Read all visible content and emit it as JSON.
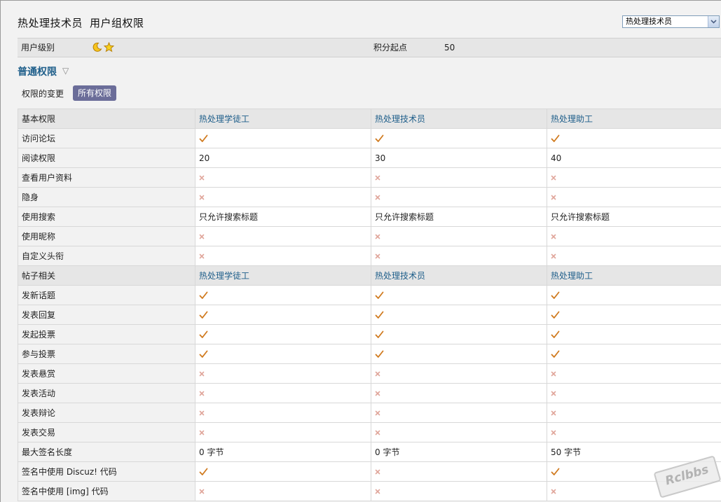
{
  "header": {
    "group_name": "热处理技术员",
    "page_label": "用户组权限",
    "selector_value": "热处理技术员"
  },
  "level_row": {
    "label": "用户级别",
    "points_label": "积分起点",
    "points_value": "50"
  },
  "section": {
    "title": "普通权限",
    "toggle": "▽",
    "tabs": [
      "权限的变更",
      "所有权限"
    ]
  },
  "table": {
    "rows": [
      {
        "type": "head",
        "cells": [
          "基本权限",
          "热处理学徒工",
          "热处理技术员",
          "热处理助工"
        ]
      },
      {
        "type": "row",
        "cells": [
          "访问论坛",
          "✓",
          "✓",
          "✓"
        ]
      },
      {
        "type": "row",
        "cells": [
          "阅读权限",
          "20",
          "30",
          "40"
        ]
      },
      {
        "type": "row",
        "cells": [
          "查看用户资料",
          "×",
          "×",
          "×"
        ]
      },
      {
        "type": "row",
        "cells": [
          "隐身",
          "×",
          "×",
          "×"
        ]
      },
      {
        "type": "row",
        "cells": [
          "使用搜索",
          "只允许搜索标题",
          "只允许搜索标题",
          "只允许搜索标题"
        ]
      },
      {
        "type": "row",
        "cells": [
          "使用昵称",
          "×",
          "×",
          "×"
        ]
      },
      {
        "type": "row",
        "cells": [
          "自定义头衔",
          "×",
          "×",
          "×"
        ]
      },
      {
        "type": "head",
        "cells": [
          "帖子相关",
          "热处理学徒工",
          "热处理技术员",
          "热处理助工"
        ]
      },
      {
        "type": "row",
        "cells": [
          "发新话题",
          "✓",
          "✓",
          "✓"
        ]
      },
      {
        "type": "row",
        "cells": [
          "发表回复",
          "✓",
          "✓",
          "✓"
        ]
      },
      {
        "type": "row",
        "cells": [
          "发起投票",
          "✓",
          "✓",
          "✓"
        ]
      },
      {
        "type": "row",
        "cells": [
          "参与投票",
          "✓",
          "✓",
          "✓"
        ]
      },
      {
        "type": "row",
        "cells": [
          "发表悬赏",
          "×",
          "×",
          "×"
        ]
      },
      {
        "type": "row",
        "cells": [
          "发表活动",
          "×",
          "×",
          "×"
        ]
      },
      {
        "type": "row",
        "cells": [
          "发表辩论",
          "×",
          "×",
          "×"
        ]
      },
      {
        "type": "row",
        "cells": [
          "发表交易",
          "×",
          "×",
          "×"
        ]
      },
      {
        "type": "row",
        "cells": [
          "最大签名长度",
          "0 字节",
          "0 字节",
          "50 字节"
        ]
      },
      {
        "type": "row",
        "cells": [
          "签名中使用 Discuz! 代码",
          "✓",
          "×",
          "✓"
        ]
      },
      {
        "type": "row",
        "cells": [
          "签名中使用 [img] 代码",
          "×",
          "×",
          "×"
        ]
      }
    ]
  },
  "watermark": "Rclbbs",
  "colors": {
    "check": "#d07a1e",
    "cross": "#e0a59a",
    "link": "#1e5e8a",
    "tab_active": "#6b6d99"
  },
  "icons": {
    "level": [
      "moon-icon",
      "star-icon"
    ],
    "check": "check-icon",
    "cross": "cross-icon",
    "dropdown": "chevron-down-icon"
  }
}
